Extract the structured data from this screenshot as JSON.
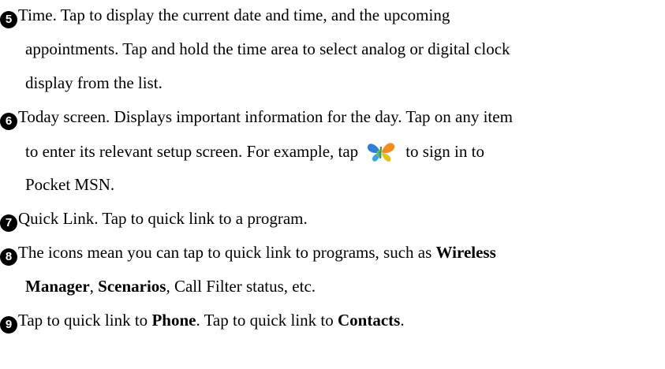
{
  "items": [
    {
      "number": "5",
      "lines": [
        "Time. Tap to display the current date and time, and the upcoming",
        "appointments. Tap and hold the time area to select analog or digital clock",
        "display from the list."
      ]
    },
    {
      "number": "6",
      "line1": "Today screen. Displays important information for the day. Tap on any item",
      "line2_before": "to enter its relevant setup screen. For example, tap",
      "line2_after": "to sign in to",
      "line3": "Pocket MSN.",
      "icon": "msn-butterfly-icon"
    },
    {
      "number": "7",
      "text": "Quick Link. Tap to quick link to a program."
    },
    {
      "number": "8",
      "line1_before": "The icons mean you can tap to quick link to programs, such as ",
      "line1_bold": "Wireless",
      "line2_bold1": "Manager",
      "line2_sep": ", ",
      "line2_bold2": "Scenarios",
      "line2_after": ", Call Filter status, etc."
    },
    {
      "number": "9",
      "before": "Tap to quick link to ",
      "bold1": "Phone",
      "middle": ". Tap to quick link to ",
      "bold2": "Contacts",
      "after": "."
    }
  ]
}
